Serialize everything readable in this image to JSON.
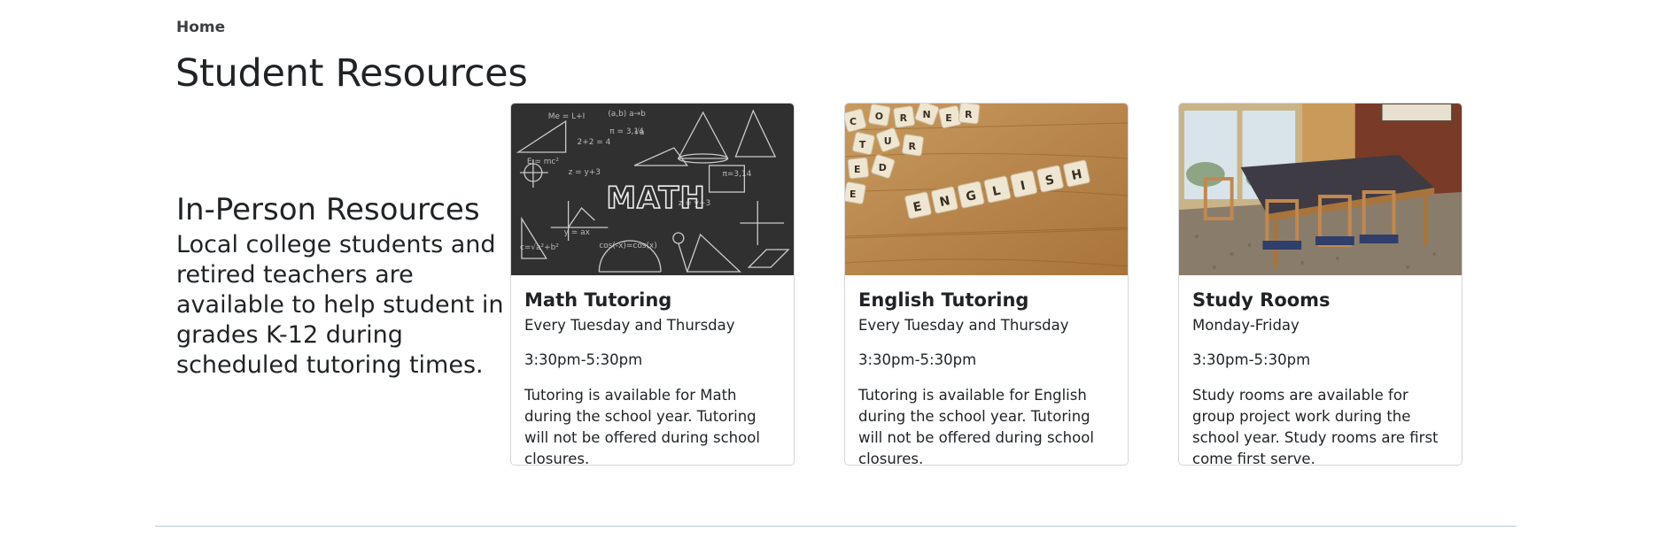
{
  "breadcrumb": {
    "home_label": "Home"
  },
  "page": {
    "title": "Student Resources"
  },
  "intro": {
    "heading": "In-Person Resources",
    "text": "Local college students and retired teachers are available to help student in grades K-12 during scheduled tutoring times."
  },
  "cards": [
    {
      "image_icon": "math-chalkboard-image",
      "image_text": "MATH",
      "title": "Math Tutoring",
      "schedule": "Every Tuesday and Thursday",
      "time": "3:30pm-5:30pm",
      "description": "Tutoring is available for Math during the school year. Tutoring will not be offered during school closures."
    },
    {
      "image_icon": "english-letter-blocks-image",
      "image_text": "ENGLISH",
      "title": "English Tutoring",
      "schedule": "Every Tuesday and Thursday",
      "time": "3:30pm-5:30pm",
      "description": "Tutoring is available for English during the school year. Tutoring will not be offered during school closures."
    },
    {
      "image_icon": "study-room-table-image",
      "title": "Study Rooms",
      "schedule": "Monday-Friday",
      "time": "3:30pm-5:30pm",
      "description": "Study rooms are available for group project work during the school year. Study rooms are first come first serve."
    }
  ],
  "colors": {
    "text": "#1f2326",
    "card_border": "#d3d6d9",
    "divider": "#b6cbd8"
  }
}
